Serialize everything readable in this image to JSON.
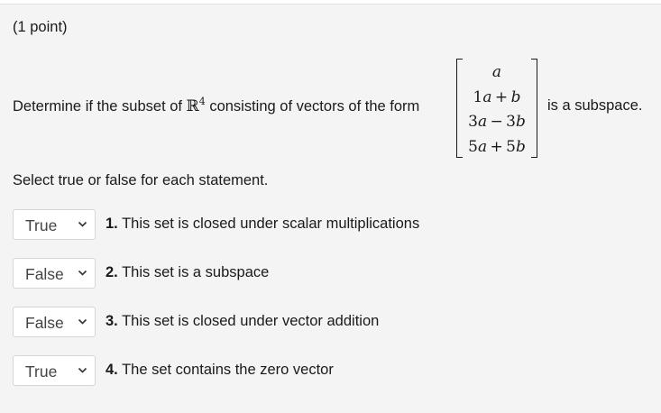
{
  "problem": {
    "points_label": "(1 point)",
    "prompt_before": "Determine if the subset of ",
    "set_symbol": "ℝ",
    "set_exponent": "4",
    "prompt_middle": " consisting of vectors of the form",
    "vector_entries": [
      "a",
      "1a + b",
      "3a − 3b",
      "5a + 5b"
    ],
    "prompt_after": "is a subspace.",
    "instructions": "Select true or false for each statement."
  },
  "statements": [
    {
      "number": "1.",
      "text": "This set is closed under scalar multiplications",
      "selected": "True"
    },
    {
      "number": "2.",
      "text": "This set is a subspace",
      "selected": "False"
    },
    {
      "number": "3.",
      "text": "This set is closed under vector addition",
      "selected": "False"
    },
    {
      "number": "4.",
      "text": "The set contains the zero vector",
      "selected": "True"
    }
  ],
  "icons": {
    "dropdown": "chevron-down-icon"
  },
  "colors": {
    "panel_background": "#f4f4f4",
    "select_background": "#ffffff",
    "text": "#1a1a1a"
  }
}
